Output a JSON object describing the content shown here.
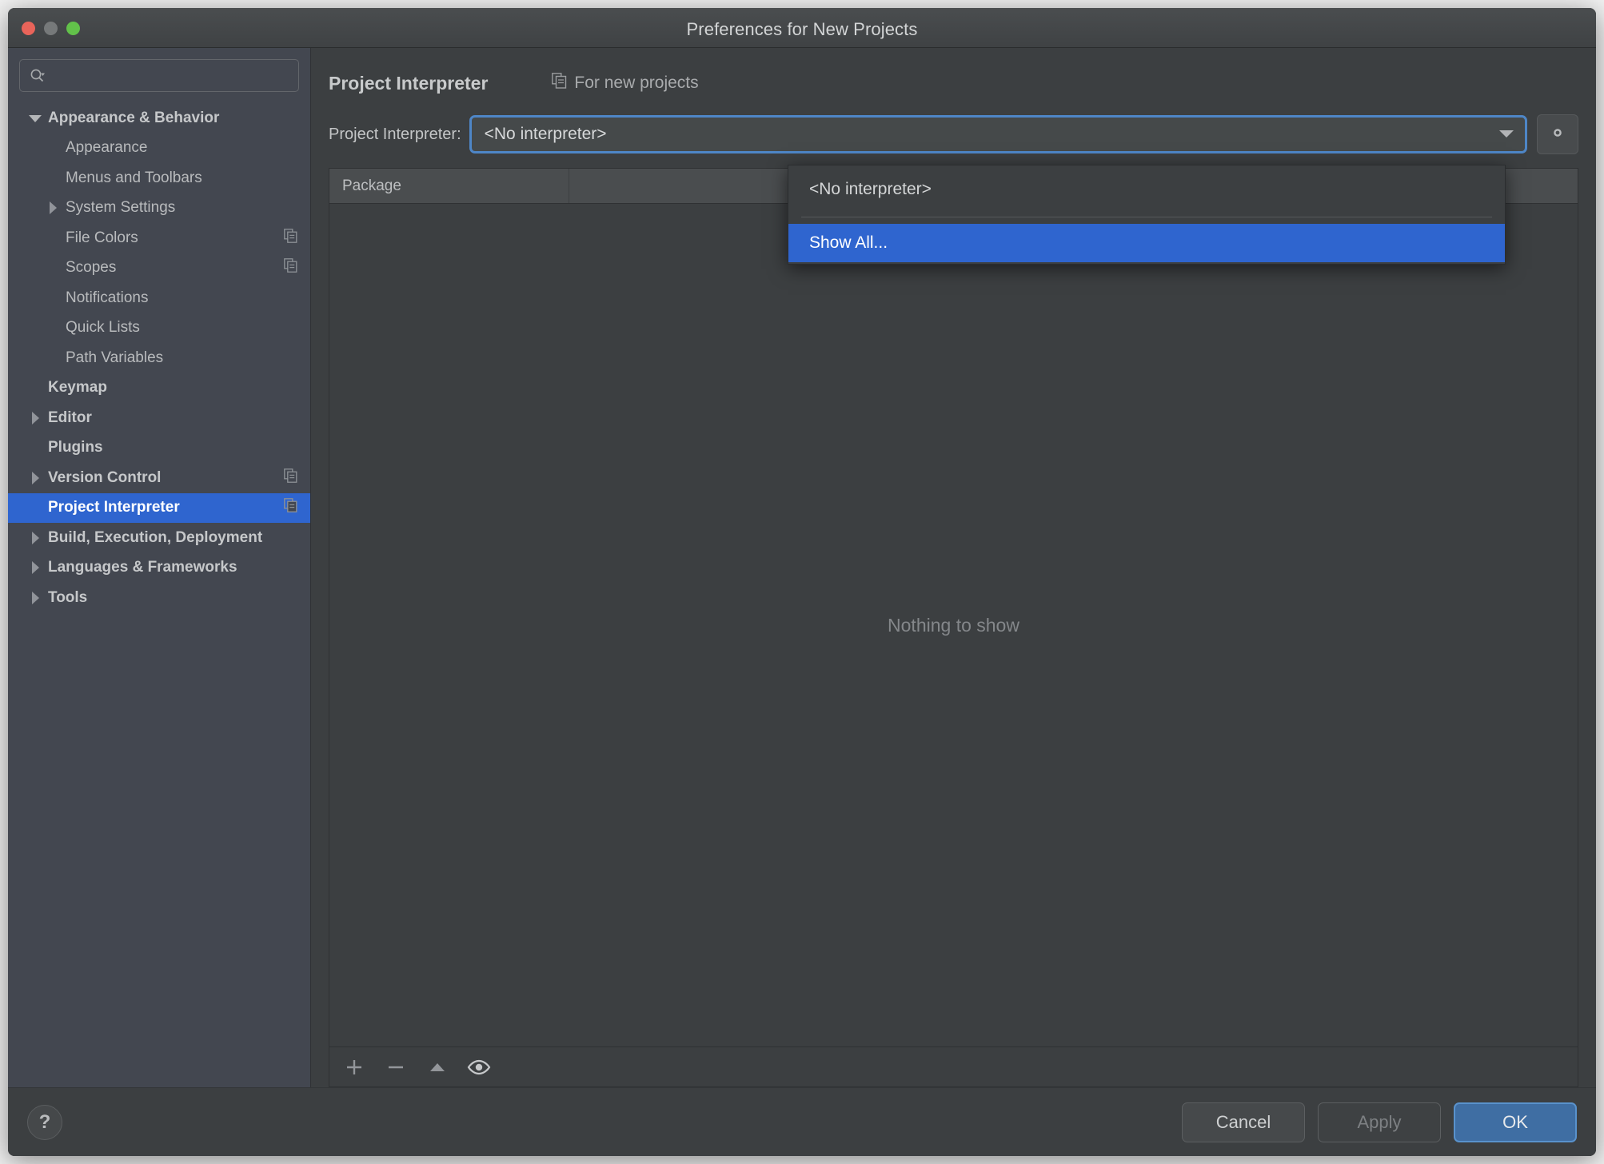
{
  "window": {
    "title": "Preferences for New Projects",
    "traffic_lights": [
      "close",
      "minimize",
      "zoom"
    ]
  },
  "sidebar": {
    "search": {
      "placeholder": "",
      "value": "",
      "icon": "search-icon"
    },
    "items": [
      {
        "label": "Appearance & Behavior",
        "level": 0,
        "bold": true,
        "twisty": "down",
        "badge": false,
        "selected": false
      },
      {
        "label": "Appearance",
        "level": 1,
        "bold": false,
        "twisty": "none",
        "badge": false,
        "selected": false
      },
      {
        "label": "Menus and Toolbars",
        "level": 1,
        "bold": false,
        "twisty": "none",
        "badge": false,
        "selected": false
      },
      {
        "label": "System Settings",
        "level": 1,
        "bold": false,
        "twisty": "right",
        "badge": false,
        "selected": false
      },
      {
        "label": "File Colors",
        "level": 1,
        "bold": false,
        "twisty": "none",
        "badge": true,
        "selected": false
      },
      {
        "label": "Scopes",
        "level": 1,
        "bold": false,
        "twisty": "none",
        "badge": true,
        "selected": false
      },
      {
        "label": "Notifications",
        "level": 1,
        "bold": false,
        "twisty": "none",
        "badge": false,
        "selected": false
      },
      {
        "label": "Quick Lists",
        "level": 1,
        "bold": false,
        "twisty": "none",
        "badge": false,
        "selected": false
      },
      {
        "label": "Path Variables",
        "level": 1,
        "bold": false,
        "twisty": "none",
        "badge": false,
        "selected": false
      },
      {
        "label": "Keymap",
        "level": 0,
        "bold": true,
        "twisty": "none",
        "badge": false,
        "selected": false
      },
      {
        "label": "Editor",
        "level": 0,
        "bold": true,
        "twisty": "right",
        "badge": false,
        "selected": false
      },
      {
        "label": "Plugins",
        "level": 0,
        "bold": true,
        "twisty": "none",
        "badge": false,
        "selected": false
      },
      {
        "label": "Version Control",
        "level": 0,
        "bold": true,
        "twisty": "right",
        "badge": true,
        "selected": false
      },
      {
        "label": "Project Interpreter",
        "level": 0,
        "bold": true,
        "twisty": "none",
        "badge": true,
        "selected": true
      },
      {
        "label": "Build, Execution, Deployment",
        "level": 0,
        "bold": true,
        "twisty": "right",
        "badge": false,
        "selected": false
      },
      {
        "label": "Languages & Frameworks",
        "level": 0,
        "bold": true,
        "twisty": "right",
        "badge": false,
        "selected": false
      },
      {
        "label": "Tools",
        "level": 0,
        "bold": true,
        "twisty": "right",
        "badge": false,
        "selected": false
      }
    ]
  },
  "main": {
    "title": "Project Interpreter",
    "scope_label": "For new projects",
    "scope_icon": "copy-icon",
    "interpreter_label": "Project Interpreter:",
    "interpreter_value": "<No interpreter>",
    "combo_arrow_icon": "chevron-down-icon",
    "gear_icon": "gear-icon",
    "packages": {
      "columns": [
        "Package",
        ""
      ],
      "rows": [],
      "empty_text": "Nothing to show",
      "toolbar": [
        {
          "icon": "plus-icon",
          "name": "add-package-button"
        },
        {
          "icon": "minus-icon",
          "name": "remove-package-button"
        },
        {
          "icon": "triangle-up-icon",
          "name": "upgrade-package-button"
        },
        {
          "icon": "eye-icon",
          "name": "show-early-releases-button"
        }
      ]
    }
  },
  "dropdown": {
    "open": true,
    "items": [
      {
        "label": "<No interpreter>",
        "selected": false,
        "separator_after": true
      },
      {
        "label": "Show All...",
        "selected": true,
        "separator_after": false
      }
    ]
  },
  "footer": {
    "help_label": "?",
    "cancel_label": "Cancel",
    "apply_label": "Apply",
    "apply_disabled": true,
    "ok_label": "OK"
  },
  "colors": {
    "accent": "#2f65cf",
    "window_bg": "#3c3f41",
    "sidebar_bg": "#434750",
    "focus_ring": "#4e86c7",
    "primary_button": "#3f6ea3",
    "text": "#c8cacb",
    "muted_text": "#84878a"
  }
}
